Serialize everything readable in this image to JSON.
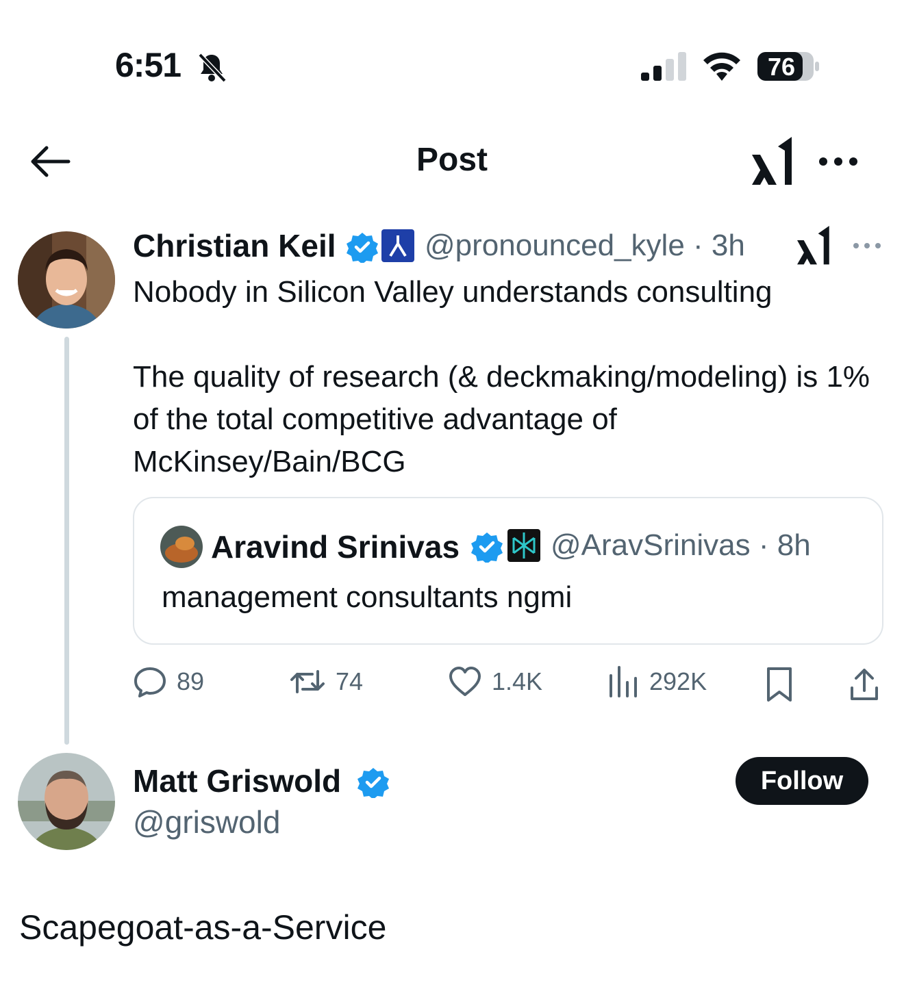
{
  "status_bar": {
    "time": "6:51",
    "battery": "76",
    "icons": [
      "bell-slash-icon",
      "cellular-signal-icon",
      "wifi-icon",
      "battery-icon"
    ]
  },
  "header": {
    "title": "Post",
    "icons": [
      "back-arrow-icon",
      "xai-logo-icon",
      "more-icon"
    ]
  },
  "thread": [
    {
      "name": "Christian Keil",
      "handle": "@pronounced_kyle",
      "time": "· 3h",
      "text": "Nobody in Silicon Valley understands consulting\n\nThe quality of research (& deckmaking/modeling) is 1% of the total competitive advantage of McKinsey/Bain/BCG",
      "quote": {
        "name": "Aravind Srinivas",
        "handle": "@AravSrinivas",
        "time": "· 8h",
        "text": "management consultants ngmi"
      },
      "actions": {
        "replies": "89",
        "reposts": "74",
        "likes": "1.4K",
        "views": "292K"
      }
    }
  ],
  "focus_post": {
    "name": "Matt Griswold",
    "handle": "@griswold",
    "follow_label": "Follow",
    "text": "Scapegoat-as-a-Service"
  },
  "colors": {
    "text": "#0f1419",
    "secondary": "#536471",
    "verified": "#1d9bf0",
    "border": "#e1e6ea",
    "thread_line": "#cfd9de"
  }
}
